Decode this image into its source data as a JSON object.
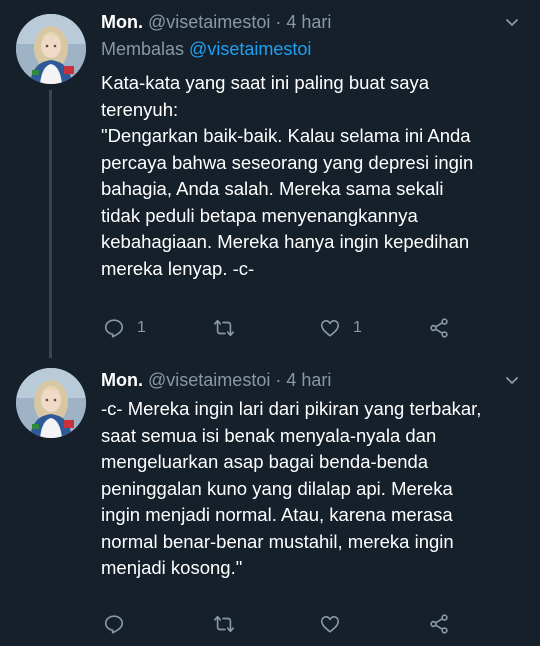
{
  "tweets": [
    {
      "name": "Mon.",
      "handle": "@visetaimestoi",
      "separator": "·",
      "time": "4 hari",
      "reply_prefix": "Membalas",
      "reply_to": "@visetaimestoi",
      "text": "Kata-kata yang saat ini paling buat saya\nterenyuh:\n\"Dengarkan baik-baik. Kalau selama ini Anda\npercaya bahwa seseorang yang depresi ingin\nbahagia, Anda salah. Mereka sama sekali\ntidak peduli betapa menyenangkannya\nkebahagiaan. Mereka hanya ingin kepedihan\nmereka lenyap. -c-",
      "reply_count": "1",
      "retweet_count": "",
      "like_count": "1"
    },
    {
      "name": "Mon.",
      "handle": "@visetaimestoi",
      "separator": "·",
      "time": "4 hari",
      "text": "-c- Mereka ingin lari dari pikiran yang terbakar,\nsaat semua isi benak menyala-nyala dan\nmengeluarkan asap bagai benda-benda\npeninggalan kuno yang dilalap api. Mereka\ningin menjadi normal. Atau, karena merasa\nnormal benar-benar mustahil, mereka ingin\nmenjadi kosong.\"",
      "reply_count": "",
      "retweet_count": "",
      "like_count": ""
    }
  ],
  "colors": {
    "background": "#15202b",
    "text": "#ffffff",
    "secondary": "#8899a6",
    "accent": "#1da1f2",
    "thread_line": "#38444d"
  }
}
